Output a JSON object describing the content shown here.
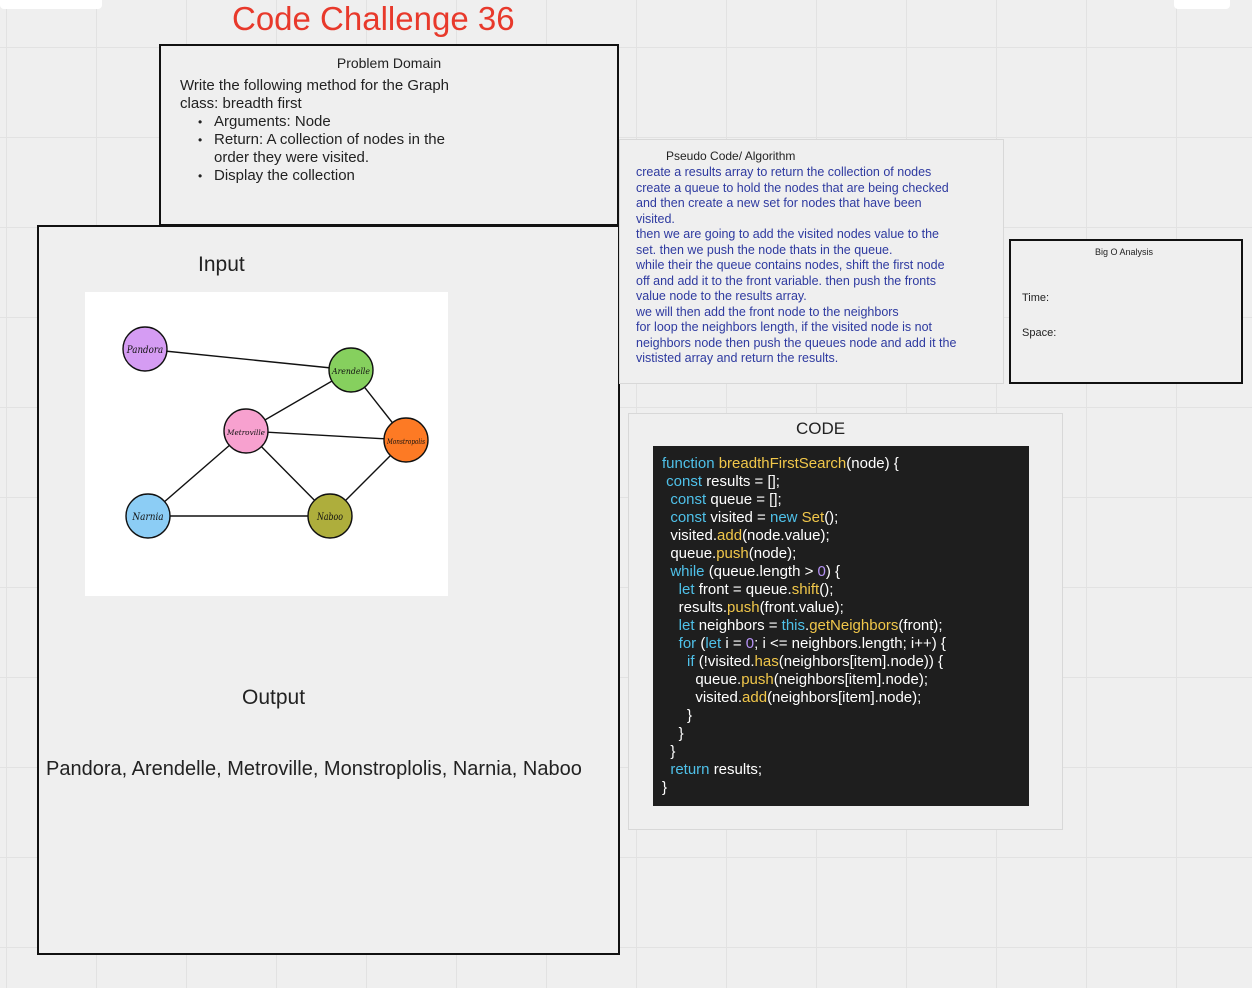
{
  "title": "Code Challenge 36",
  "problem": {
    "heading": "Problem Domain",
    "description": "Write the following method for the Graph class: breadth first",
    "bullets": [
      "Arguments: Node",
      "Return: A collection of nodes in the order they were visited.",
      "Display the collection"
    ]
  },
  "input_label": "Input",
  "output_label": "Output",
  "output_text": "Pandora, Arendelle, Metroville, Monstroplolis, Narnia, Naboo",
  "graph": {
    "nodes": [
      {
        "id": "pandora",
        "label": "Pandora",
        "color": "#d59cf3"
      },
      {
        "id": "arendelle",
        "label": "Arendelle",
        "color": "#86d05e"
      },
      {
        "id": "metroville",
        "label": "Metroville",
        "color": "#f7a1cf"
      },
      {
        "id": "monstropolis",
        "label": "Monstropolis",
        "color": "#fd7a24"
      },
      {
        "id": "narnia",
        "label": "Narnia",
        "color": "#8ccdf5"
      },
      {
        "id": "naboo",
        "label": "Naboo",
        "color": "#aeae3c"
      }
    ],
    "edges": [
      [
        "pandora",
        "arendelle"
      ],
      [
        "arendelle",
        "metroville"
      ],
      [
        "arendelle",
        "monstropolis"
      ],
      [
        "metroville",
        "monstropolis"
      ],
      [
        "metroville",
        "narnia"
      ],
      [
        "metroville",
        "naboo"
      ],
      [
        "narnia",
        "naboo"
      ],
      [
        "monstropolis",
        "naboo"
      ]
    ]
  },
  "pseudo": {
    "heading": "Pseudo Code/ Algorithm",
    "lines": [
      "create a results array to return the collection of nodes",
      "create a queue to hold the nodes that are being checked",
      "and then create a new set for nodes that have been",
      "visited.",
      "then we are going to add the visited nodes value to the",
      "set. then we push the node thats in the queue.",
      "while their the queue contains nodes, shift the first node",
      "off and add it to the front variable. then push the fronts",
      "value node to the results array.",
      "we will then add the front node to the neighbors",
      "for loop the neighbors length, if the visited node is not",
      "neighbors node  then push the queues node and add it the",
      "vististed array and return the results."
    ]
  },
  "bigo": {
    "heading": "Big O Analysis",
    "time_label": "Time:",
    "space_label": "Space:"
  },
  "code": {
    "label": "CODE",
    "lines": [
      [
        [
          "kw",
          "function "
        ],
        [
          "fn",
          "breadthFirstSearch"
        ],
        [
          "",
          "(node) {"
        ]
      ],
      [
        [
          "kw",
          " const "
        ],
        [
          "",
          "results = [];"
        ]
      ],
      [
        [
          "kw",
          "  const "
        ],
        [
          "",
          "queue = [];"
        ]
      ],
      [
        [
          "kw",
          "  const "
        ],
        [
          "",
          "visited = "
        ],
        [
          "kw",
          "new "
        ],
        [
          "fn",
          "Set"
        ],
        [
          "",
          "();"
        ]
      ],
      [
        [
          "",
          "  visited."
        ],
        [
          "fn",
          "add"
        ],
        [
          "",
          "(node.value);"
        ]
      ],
      [
        [
          "",
          "  queue."
        ],
        [
          "fn",
          "push"
        ],
        [
          "",
          "(node);"
        ]
      ],
      [
        [
          "kw",
          "  while "
        ],
        [
          "",
          "(queue.length > "
        ],
        [
          "num",
          "0"
        ],
        [
          "",
          ") {"
        ]
      ],
      [
        [
          "kw",
          "    let "
        ],
        [
          "",
          "front = queue."
        ],
        [
          "fn",
          "shift"
        ],
        [
          "",
          "();"
        ]
      ],
      [
        [
          "",
          "    results."
        ],
        [
          "fn",
          "push"
        ],
        [
          "",
          "(front.value);"
        ]
      ],
      [
        [
          "kw",
          "    let "
        ],
        [
          "",
          "neighbors = "
        ],
        [
          "kw",
          "this"
        ],
        [
          "",
          "."
        ],
        [
          "fn",
          "getNeighbors"
        ],
        [
          "",
          "(front);"
        ]
      ],
      [
        [
          "kw",
          "    for "
        ],
        [
          "",
          "("
        ],
        [
          "kw",
          "let "
        ],
        [
          "",
          "i = "
        ],
        [
          "num",
          "0"
        ],
        [
          "",
          "; i <= neighbors.length; i++) {"
        ]
      ],
      [
        [
          "kw",
          "      if "
        ],
        [
          "",
          "(!visited."
        ],
        [
          "fn",
          "has"
        ],
        [
          "",
          "(neighbors[item].node)) {"
        ]
      ],
      [
        [
          "",
          "        queue."
        ],
        [
          "fn",
          "push"
        ],
        [
          "",
          "(neighbors[item].node);"
        ]
      ],
      [
        [
          "",
          "        visited."
        ],
        [
          "fn",
          "add"
        ],
        [
          "",
          "(neighbors[item].node);"
        ]
      ],
      [
        [
          "",
          "      }"
        ]
      ],
      [
        [
          "",
          "    }"
        ]
      ],
      [
        [
          "",
          "  }"
        ]
      ],
      [
        [
          "kw",
          "  return "
        ],
        [
          "",
          "results;"
        ]
      ],
      [
        [
          "",
          "}"
        ]
      ]
    ]
  }
}
